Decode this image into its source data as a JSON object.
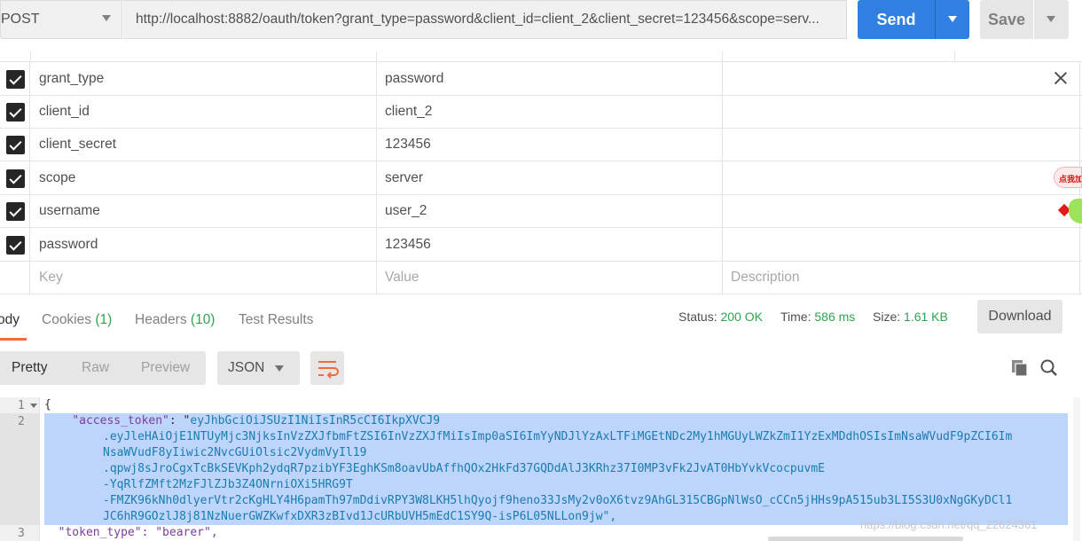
{
  "request": {
    "method": "POST",
    "url": "http://localhost:8882/oauth/token?grant_type=password&client_id=client_2&client_secret=123456&scope=serv...",
    "send_label": "Send",
    "save_label": "Save"
  },
  "params": {
    "rows": [
      {
        "key": "grant_type",
        "value": "password",
        "checked": true
      },
      {
        "key": "client_id",
        "value": "client_2",
        "checked": true
      },
      {
        "key": "client_secret",
        "value": "123456",
        "checked": true
      },
      {
        "key": "scope",
        "value": "server",
        "checked": true
      },
      {
        "key": "username",
        "value": "user_2",
        "checked": true
      },
      {
        "key": "password",
        "value": "123456",
        "checked": true
      }
    ],
    "new_row": {
      "key_placeholder": "Key",
      "value_placeholder": "Value",
      "description_placeholder": "Description"
    }
  },
  "side_widget": {
    "bubble_text": "点我加"
  },
  "response": {
    "tabs": [
      {
        "label": "ody",
        "count": "",
        "active": true
      },
      {
        "label": "Cookies",
        "count": "(1)",
        "active": false
      },
      {
        "label": "Headers",
        "count": "(10)",
        "active": false
      },
      {
        "label": "Test Results",
        "count": "",
        "active": false
      }
    ],
    "status_label": "Status:",
    "status_value": "200 OK",
    "time_label": "Time:",
    "time_value": "586 ms",
    "size_label": "Size:",
    "size_value": "1.61 KB",
    "download_label": "Download",
    "format_options": [
      "Pretty",
      "Raw",
      "Preview"
    ],
    "format_selected": "Pretty",
    "language": "JSON"
  },
  "code": {
    "line_numbers": [
      "1",
      "2",
      "3"
    ],
    "line1": "{",
    "line2_key": "\"access_token\"",
    "line2_sep": ": \"",
    "token_lines": [
      "eyJhbGciOiJSUzI1NiIsInR5cCI6IkpXVCJ9",
      ".eyJleHAiOjE1NTUyMjc3NjksInVzZXJfbmFtZSI6InVzZXJfMiIsImp0aSI6ImYyNDJlYzAxLTFiMGEtNDc2My1hMGUyLWZkZmI1YzExMDdhOSIsImNsaWVudF9pZCI6Im",
      "NsaWVudF8yIiwic2NvcGUiOlsic2VydmVyIl19",
      ".qpwj8sJroCgxTcBkSEVKph2ydqR7pzibYF3EghKSm8oavUbAffhQOx2HkFd37GQDdAlJ3KRhz37I0MP3vFk2JvAT0HbYvkVcocpuvmE",
      "-YqRlfZMft2MzFJlZJb3Z4ONrniOXi5HRG9T",
      "-FMZK96kNh0dlyerVtr2cKgHLY4H6pamTh97mDdivRPY3W8LKH5lhQyojf9heno33JsMy2v0oX6tvz9AhGL315CBGpNlWsO_cCCn5jHHs9pA515ub3LI5S3U0xNgGKyDCl1",
      "JC6hR9GOzlJ8j81NzNuerGWZKwfxDXR3zBIvd1JcURbUVH5mEdC1SY9Q-isP6L05NLLon9jw\","
    ],
    "line3": "  \"token_type\": \"bearer\","
  },
  "watermark": "https://blog.csdn.net/qq_22624361"
}
